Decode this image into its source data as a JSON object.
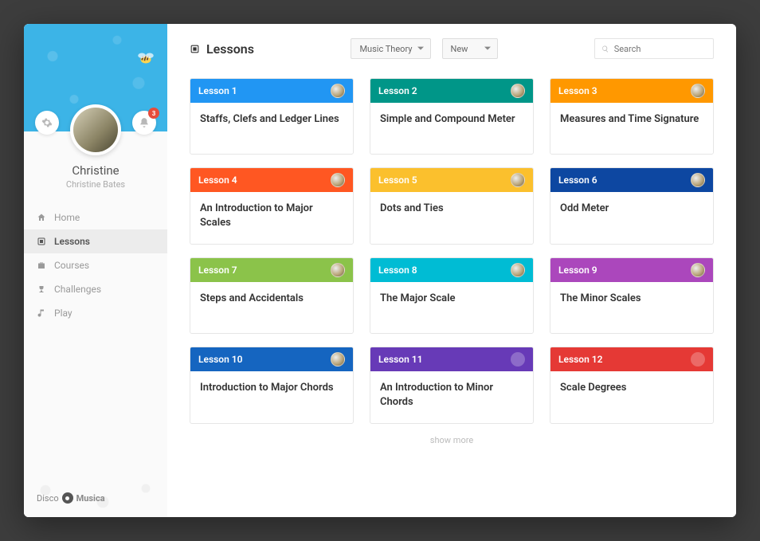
{
  "sidebar": {
    "user": {
      "display_name": "Christine",
      "full_name": "Christine Bates"
    },
    "notifications_count": "3",
    "nav": [
      {
        "label": "Home"
      },
      {
        "label": "Lessons"
      },
      {
        "label": "Courses"
      },
      {
        "label": "Challenges"
      },
      {
        "label": "Play"
      }
    ],
    "brand": {
      "part1": "Disco",
      "part2": "Musica"
    }
  },
  "header": {
    "title": "Lessons",
    "filter_category": "Music Theory",
    "filter_sort": "New",
    "search_placeholder": "Search"
  },
  "lessons": [
    {
      "badge": "Lesson 1",
      "title": "Staffs, Clefs and Ledger Lines",
      "color": "c1",
      "avatar": true
    },
    {
      "badge": "Lesson 2",
      "title": "Simple and Compound Meter",
      "color": "c2",
      "avatar": true
    },
    {
      "badge": "Lesson 3",
      "title": "Measures and Time Signature",
      "color": "c3",
      "avatar": true
    },
    {
      "badge": "Lesson 4",
      "title": "An Introduction to Major Scales",
      "color": "c4",
      "avatar": true
    },
    {
      "badge": "Lesson 5",
      "title": "Dots and Ties",
      "color": "c5",
      "avatar": true
    },
    {
      "badge": "Lesson 6",
      "title": "Odd Meter",
      "color": "c6",
      "avatar": true
    },
    {
      "badge": "Lesson 7",
      "title": "Steps and Accidentals",
      "color": "c7",
      "avatar": true
    },
    {
      "badge": "Lesson 8",
      "title": "The Major Scale",
      "color": "c8",
      "avatar": true
    },
    {
      "badge": "Lesson 9",
      "title": "The Minor Scales",
      "color": "c9",
      "avatar": true
    },
    {
      "badge": "Lesson 10",
      "title": "Introduction to Major Chords",
      "color": "c10",
      "avatar": true
    },
    {
      "badge": "Lesson 11",
      "title": "An Introduction to Minor Chords",
      "color": "c11",
      "avatar": false
    },
    {
      "badge": "Lesson 12",
      "title": "Scale Degrees",
      "color": "c12",
      "avatar": false
    }
  ],
  "footer": {
    "show_more": "show more"
  }
}
